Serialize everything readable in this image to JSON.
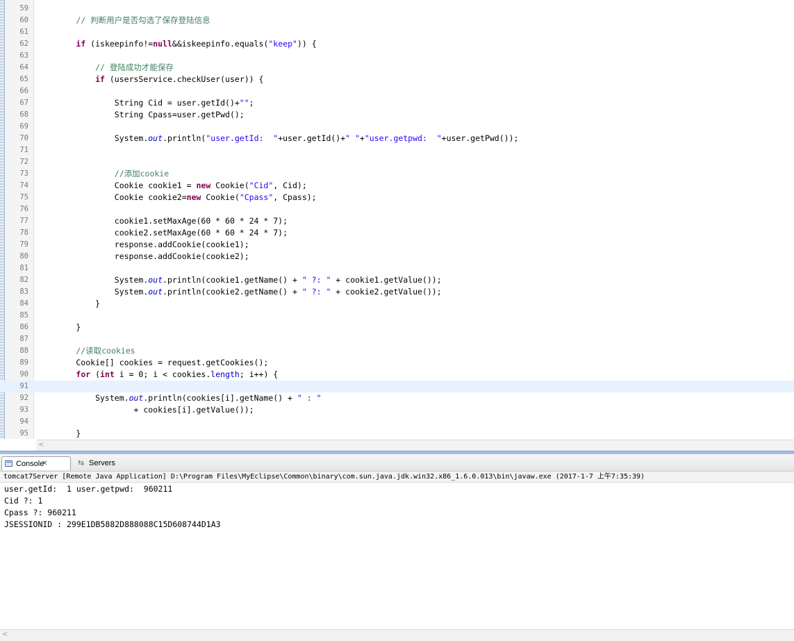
{
  "editor": {
    "lines": [
      {
        "num": "59",
        "tokens": []
      },
      {
        "num": "60",
        "tokens": [
          {
            "t": "        "
          },
          {
            "c": "cm",
            "t": "// 判断用户是否勾选了保存登陆信息"
          }
        ]
      },
      {
        "num": "61",
        "tokens": []
      },
      {
        "num": "62",
        "tokens": [
          {
            "t": "        "
          },
          {
            "c": "kw",
            "t": "if"
          },
          {
            "t": " (iskeepinfo!="
          },
          {
            "c": "kw",
            "t": "null"
          },
          {
            "t": "&&iskeepinfo.equals("
          },
          {
            "c": "str",
            "t": "\"keep\""
          },
          {
            "t": ")) {"
          }
        ]
      },
      {
        "num": "63",
        "tokens": []
      },
      {
        "num": "64",
        "tokens": [
          {
            "t": "            "
          },
          {
            "c": "cm",
            "t": "// 登陆成功才能保存"
          }
        ]
      },
      {
        "num": "65",
        "tokens": [
          {
            "t": "            "
          },
          {
            "c": "kw",
            "t": "if"
          },
          {
            "t": " (usersService.checkUser(user)) {"
          }
        ]
      },
      {
        "num": "66",
        "tokens": []
      },
      {
        "num": "67",
        "tokens": [
          {
            "t": "                String Cid = user.getId()+"
          },
          {
            "c": "str",
            "t": "\"\""
          },
          {
            "t": ";"
          }
        ]
      },
      {
        "num": "68",
        "tokens": [
          {
            "t": "                String Cpass=user.getPwd();"
          }
        ]
      },
      {
        "num": "69",
        "tokens": []
      },
      {
        "num": "70",
        "tokens": [
          {
            "t": "                System."
          },
          {
            "c": "st",
            "t": "out"
          },
          {
            "t": ".println("
          },
          {
            "c": "str",
            "t": "\"user.getId:  \""
          },
          {
            "t": "+user.getId()+"
          },
          {
            "c": "str",
            "t": "\" \""
          },
          {
            "t": "+"
          },
          {
            "c": "str",
            "t": "\"user.getpwd:  \""
          },
          {
            "t": "+user.getPwd());"
          }
        ]
      },
      {
        "num": "71",
        "tokens": []
      },
      {
        "num": "72",
        "tokens": []
      },
      {
        "num": "73",
        "tokens": [
          {
            "t": "                "
          },
          {
            "c": "cm",
            "t": "//添加cookie"
          }
        ]
      },
      {
        "num": "74",
        "tokens": [
          {
            "t": "                Cookie cookie1 = "
          },
          {
            "c": "kw",
            "t": "new"
          },
          {
            "t": " Cookie("
          },
          {
            "c": "str",
            "t": "\"Cid\""
          },
          {
            "t": ", Cid);"
          }
        ]
      },
      {
        "num": "75",
        "tokens": [
          {
            "t": "                Cookie cookie2="
          },
          {
            "c": "kw",
            "t": "new"
          },
          {
            "t": " Cookie("
          },
          {
            "c": "str",
            "t": "\"Cpass\""
          },
          {
            "t": ", Cpass);"
          }
        ]
      },
      {
        "num": "76",
        "tokens": []
      },
      {
        "num": "77",
        "tokens": [
          {
            "t": "                cookie1.setMaxAge(60 * 60 * 24 * 7);"
          }
        ]
      },
      {
        "num": "78",
        "tokens": [
          {
            "t": "                cookie2.setMaxAge(60 * 60 * 24 * 7);"
          }
        ]
      },
      {
        "num": "79",
        "tokens": [
          {
            "t": "                response.addCookie(cookie1);"
          }
        ]
      },
      {
        "num": "80",
        "tokens": [
          {
            "t": "                response.addCookie(cookie2);"
          }
        ]
      },
      {
        "num": "81",
        "tokens": []
      },
      {
        "num": "82",
        "tokens": [
          {
            "t": "                System."
          },
          {
            "c": "st",
            "t": "out"
          },
          {
            "t": ".println(cookie1.getName() + "
          },
          {
            "c": "str",
            "t": "\" ?: \""
          },
          {
            "t": " + cookie1.getValue());"
          }
        ]
      },
      {
        "num": "83",
        "tokens": [
          {
            "t": "                System."
          },
          {
            "c": "st",
            "t": "out"
          },
          {
            "t": ".println(cookie2.getName() + "
          },
          {
            "c": "str",
            "t": "\" ?: \""
          },
          {
            "t": " + cookie2.getValue());"
          }
        ]
      },
      {
        "num": "84",
        "tokens": [
          {
            "t": "            }"
          }
        ]
      },
      {
        "num": "85",
        "tokens": []
      },
      {
        "num": "86",
        "tokens": [
          {
            "t": "        }"
          }
        ]
      },
      {
        "num": "87",
        "tokens": []
      },
      {
        "num": "88",
        "tokens": [
          {
            "t": "        "
          },
          {
            "c": "cm",
            "t": "//读取cookies"
          }
        ]
      },
      {
        "num": "89",
        "tokens": [
          {
            "t": "        Cookie[] cookies = request.getCookies();"
          }
        ]
      },
      {
        "num": "90",
        "tokens": [
          {
            "t": "        "
          },
          {
            "c": "kw",
            "t": "for"
          },
          {
            "t": " ("
          },
          {
            "c": "kw",
            "t": "int"
          },
          {
            "t": " i = 0; i < cookies."
          },
          {
            "c": "fld",
            "t": "length"
          },
          {
            "t": "; i++) {"
          }
        ]
      },
      {
        "num": "91",
        "tokens": [],
        "current": true
      },
      {
        "num": "92",
        "tokens": [
          {
            "t": "            System."
          },
          {
            "c": "st",
            "t": "out"
          },
          {
            "t": ".println(cookies[i].getName() + "
          },
          {
            "c": "str",
            "t": "\" : \""
          }
        ]
      },
      {
        "num": "93",
        "tokens": [
          {
            "t": "                    + cookies[i].getValue());"
          }
        ]
      },
      {
        "num": "94",
        "tokens": []
      },
      {
        "num": "95",
        "tokens": [
          {
            "t": "        }"
          }
        ]
      }
    ]
  },
  "console": {
    "tabs": {
      "console_label": "Console",
      "servers_label": "Servers"
    },
    "launch_info": "tomcat7Server [Remote Java Application] D:\\Program Files\\MyEclipse\\Common\\binary\\com.sun.java.jdk.win32.x86_1.6.0.013\\bin\\javaw.exe (2017-1-7 上午7:35:39)",
    "output_lines": [
      "user.getId:  1 user.getpwd:  960211",
      "Cid ?: 1",
      "Cpass ?: 960211",
      "JSESSIONID : 299E1DB5882D888088C15D608744D1A3"
    ]
  },
  "icons": {
    "console_tab_icon": "console-icon",
    "console_tab_close": "close-icon",
    "servers_tab_icon": "servers-icon",
    "scroll_left": "scroll-left-arrow-icon"
  },
  "colors": {
    "keyword": "#7f0055",
    "string": "#2a00ff",
    "comment": "#3f7f5f",
    "static_field": "#0000c0",
    "current_line": "#e8f2fe",
    "divider": "#a3bde3"
  }
}
